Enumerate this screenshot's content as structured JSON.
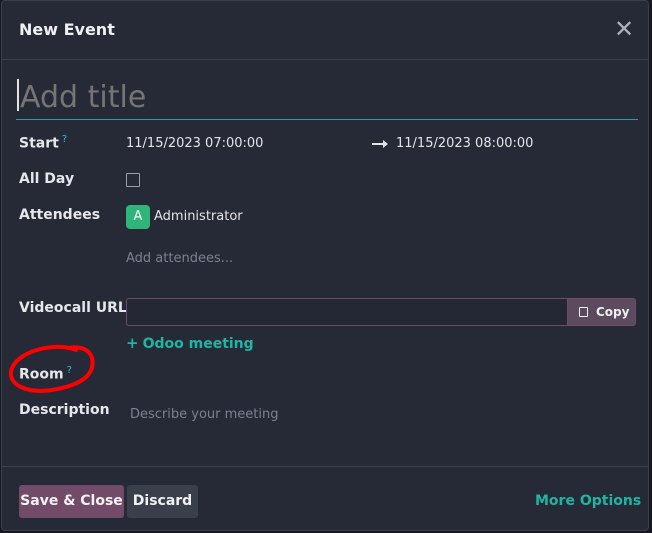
{
  "dialog": {
    "title": "New Event",
    "close_icon": "close-icon"
  },
  "event_title": {
    "placeholder": "Add title",
    "value": ""
  },
  "fields": {
    "start": {
      "label": "Start",
      "help": "?",
      "start_value": "11/15/2023 07:00:00",
      "end_value": "11/15/2023 08:00:00",
      "arrow_icon": "arrow-right-icon"
    },
    "all_day": {
      "label": "All Day",
      "checked": false
    },
    "attendees": {
      "label": "Attendees",
      "attendee_avatar": "A",
      "attendee_name": "Administrator",
      "add_placeholder": "Add attendees..."
    },
    "videocall": {
      "label": "Videocall URL",
      "value": "",
      "copy_label": "Copy",
      "copy_icon": "copy-icon",
      "meeting_link": "Odoo meeting",
      "meeting_icon": "plus-icon"
    },
    "room": {
      "label": "Room",
      "help": "?"
    },
    "description": {
      "label": "Description",
      "placeholder": "Describe your meeting"
    }
  },
  "footer": {
    "save_label": "Save & Close",
    "discard_label": "Discard",
    "more_options_label": "More Options"
  },
  "colors": {
    "dialog_bg": "#262a36",
    "primary": "#714b67",
    "accent_teal": "#1fb5a2",
    "annotation_red": "#ff0000"
  }
}
